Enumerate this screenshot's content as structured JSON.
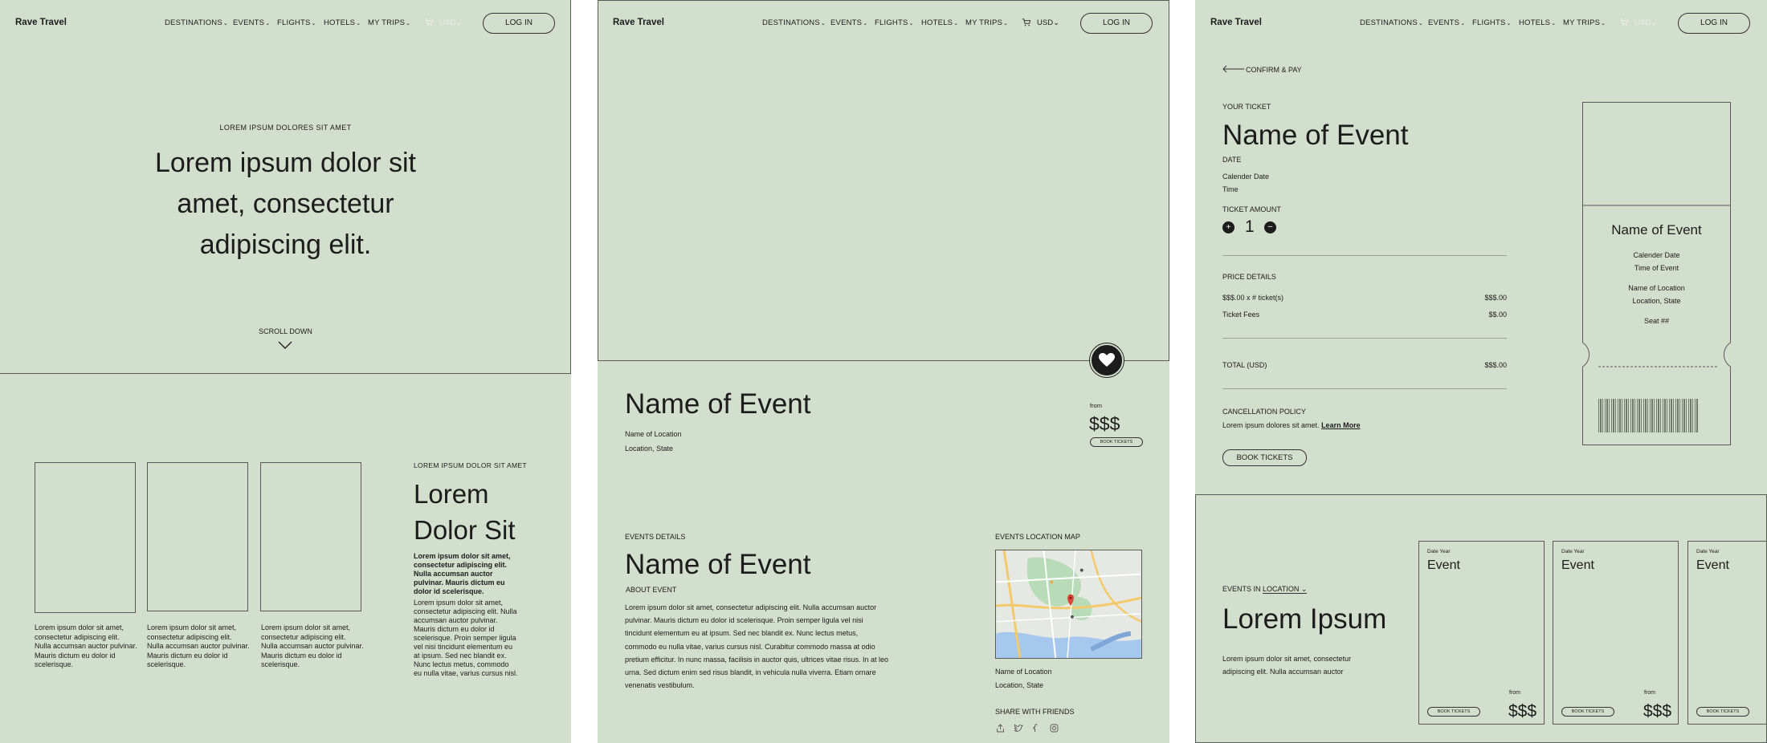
{
  "brand": "Rave Travel",
  "nav": {
    "items": [
      {
        "label": "DESTINATIONS"
      },
      {
        "label": "EVENTS"
      },
      {
        "label": "FLIGHTS"
      },
      {
        "label": "HOTELS"
      },
      {
        "label": "MY TRIPS"
      }
    ],
    "currency": "USD",
    "login_label": "LOG IN"
  },
  "landing": {
    "hero_eyebrow": "LOREM IPSUM DOLORES SIT AMET",
    "hero_title_lines": [
      "Lorem ipsum dolor sit",
      "amet, consectetur",
      "adipiscing elit."
    ],
    "scroll_label": "SCROLL DOWN",
    "cards": [
      {
        "text": "Lorem ipsum dolor sit amet, consectetur adipiscing elit. Nulla accumsan auctor pulvinar. Mauris dictum eu dolor id scelerisque."
      },
      {
        "text": "Lorem ipsum dolor sit amet, consectetur adipiscing elit. Nulla accumsan auctor pulvinar. Mauris dictum eu dolor id scelerisque."
      },
      {
        "text": "Lorem ipsum dolor sit amet, consectetur adipiscing elit. Nulla accumsan auctor pulvinar. Mauris dictum eu dolor id scelerisque."
      }
    ],
    "side_eyebrow": "LOREM IPSUM DOLOR SIT AMET",
    "side_title": "Lorem Dolor Sit",
    "side_bold_text": "Lorem ipsum dolor sit amet, consectetur adipiscing elit. Nulla accumsan auctor pulvinar. Mauris dictum eu dolor id scelerisque.",
    "side_text": "Lorem ipsum dolor sit amet, consectetur adipiscing elit. Nulla accumsan auctor pulvinar. Mauris dictum eu dolor id scelerisque. Proin semper ligula vel nisi tincidunt elementum eu at ipsum. Sed nec blandit ex. Nunc lectus metus, commodo eu nulla vitae, varius cursus nisl."
  },
  "event_page": {
    "title": "Name of Event",
    "location_name": "Name of Location",
    "location_state": "Location, State",
    "from_label": "from",
    "price": "$$$",
    "book_label": "BOOK TICKETS",
    "details_eyebrow": "EVENTS DETAILS",
    "details_title": "Name of Event",
    "about_label": "ABOUT EVENT",
    "about_text": "Lorem ipsum dolor sit amet, consectetur adipiscing elit. Nulla accumsan auctor pulvinar. Mauris dictum eu dolor id scelerisque. Proin semper ligula vel nisi tincidunt elementum eu at ipsum. Sed nec blandit ex. Nunc lectus metus, commodo eu nulla vitae, varius cursus nisl. Curabitur commodo massa at odio pretium efficitur. In nunc massa, facilisis in auctor quis, ultrices vitae risus. In at leo urna. Sed dictum enim sed risus blandit, in vehicula nulla viverra. Etiam ornare venenatis vestibulum.",
    "map_label": "EVENTS LOCATION MAP",
    "map_location_name": "Name of Location",
    "map_location_state": "Location, State",
    "share_label": "SHARE WITH FRIENDS",
    "share_icons": [
      "share-icon",
      "twitter-icon",
      "facebook-icon",
      "instagram-icon"
    ]
  },
  "checkout": {
    "back_label": "CONFIRM & PAY",
    "your_ticket_label": "YOUR TICKET",
    "title": "Name of Event",
    "date_label": "DATE",
    "calendar_date": "Calender Date",
    "time": "Time",
    "ticket_amount_label": "TICKET AMOUNT",
    "quantity": "1",
    "price_details_label": "PRICE DETAILS",
    "line_items": [
      {
        "label": "$$$.00 x # ticket(s)",
        "value": "$$$.00"
      },
      {
        "label": "Ticket Fees",
        "value": "$$.00"
      }
    ],
    "total_label": "TOTAL (USD)",
    "total_value": "$$$.00",
    "cancel_label": "CANCELLATION POLICY",
    "cancel_text": "Lorem ipsum dolores sit amet.",
    "learn_more": "Learn More",
    "book_label": "BOOK TICKETS",
    "ticket": {
      "title": "Name of Event",
      "calendar_date": "Calender Date",
      "time": "Time of Event",
      "location_name": "Name of Location",
      "location_state": "Location, State",
      "seat": "Seat ##"
    },
    "events_in_label": "EVENTS IN",
    "events_in_location": "LOCATION",
    "lorem_title": "Lorem Ipsum",
    "lorem_text": "Lorem ipsum dolor sit amet, consectetur adipiscing elit. Nulla accumsan auctor",
    "event_cards": [
      {
        "date": "Date Year",
        "title": "Event",
        "book": "BOOK TICKETS",
        "from": "from",
        "price": "$$$"
      },
      {
        "date": "Date Year",
        "title": "Event",
        "book": "BOOK TICKETS",
        "from": "from",
        "price": "$$$"
      },
      {
        "date": "Date Year",
        "title": "Event",
        "book": "BOOK TICKETS",
        "from": "",
        "price": ""
      }
    ]
  }
}
